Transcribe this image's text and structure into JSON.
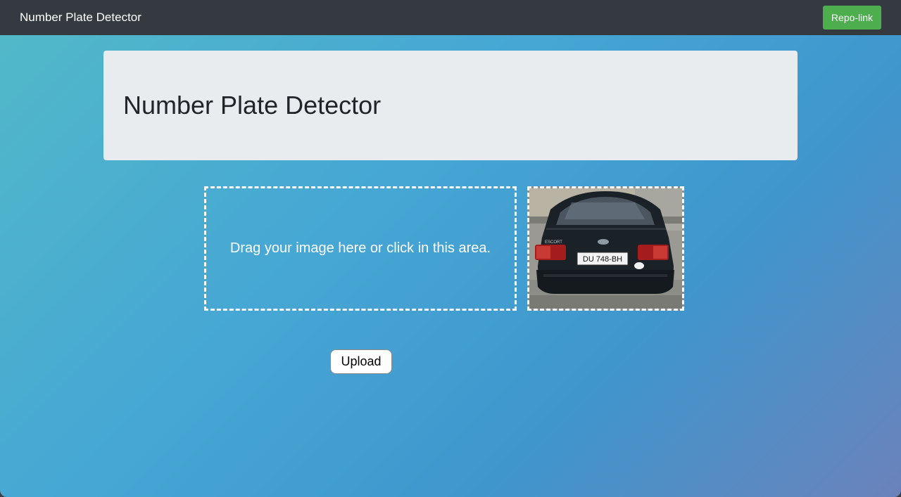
{
  "navbar": {
    "brand": "Number Plate Detector",
    "repo_link_label": "Repo-link"
  },
  "jumbotron": {
    "title": "Number Plate Detector"
  },
  "dropzone": {
    "text": "Drag your image here or click in this area."
  },
  "preview": {
    "plate_text": "DU 748-BH",
    "badge_text": "ESCORT"
  },
  "upload": {
    "label": "Upload"
  },
  "colors": {
    "navbar_bg": "#343a40",
    "repo_button": "#4cae4c",
    "jumbotron_bg": "#e9ecef",
    "gradient_start": "#52b9c8",
    "gradient_end": "#6b82bb"
  }
}
